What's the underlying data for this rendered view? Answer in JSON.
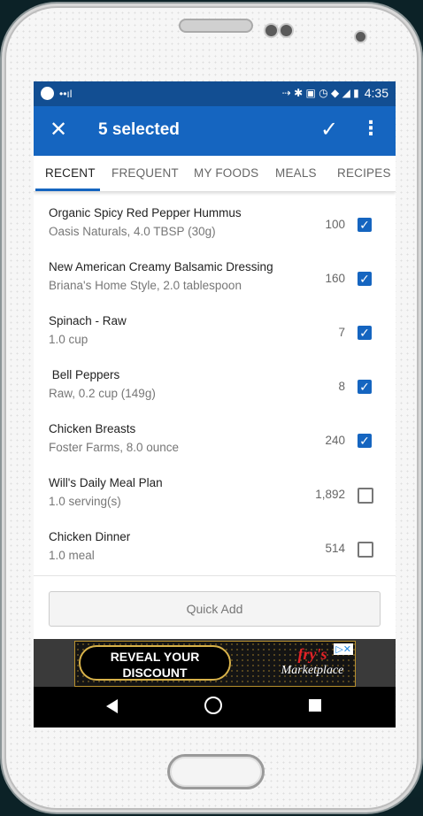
{
  "statusbar": {
    "time": "4:35",
    "signal": "••ıl",
    "icons_right": "⇢ ✱ ▣ ◷ ◆ ◢ ▮"
  },
  "appbar": {
    "close_icon": "✕",
    "title": "5 selected",
    "check_icon": "✓",
    "more_icon": "⋮"
  },
  "tabs": [
    {
      "label": "RECENT",
      "active": true
    },
    {
      "label": "FREQUENT",
      "active": false
    },
    {
      "label": "MY FOODS",
      "active": false
    },
    {
      "label": "MEALS",
      "active": false
    },
    {
      "label": "RECIPES",
      "active": false
    }
  ],
  "items": [
    {
      "name": "Organic Spicy Red Pepper Hummus",
      "detail": "Oasis Naturals, 4.0 TBSP (30g)",
      "calories": "100",
      "checked": true
    },
    {
      "name": "New American Creamy Balsamic Dressing",
      "detail": "Briana's Home Style, 2.0 tablespoon",
      "calories": "160",
      "checked": true
    },
    {
      "name": "Spinach - Raw",
      "detail": "1.0 cup",
      "calories": "7",
      "checked": true
    },
    {
      "name": " Bell Peppers",
      "detail": "Raw, 0.2 cup (149g)",
      "calories": "8",
      "checked": true
    },
    {
      "name": "Chicken Breasts",
      "detail": "Foster Farms, 8.0 ounce",
      "calories": "240",
      "checked": true
    },
    {
      "name": "Will's Daily Meal Plan",
      "detail": "1.0 serving(s)",
      "calories": "1,892",
      "checked": false
    },
    {
      "name": "Chicken Dinner",
      "detail": "1.0 meal",
      "calories": "514",
      "checked": false
    }
  ],
  "quick_add_label": "Quick Add",
  "ad": {
    "line1": "REVEAL YOUR",
    "line2": "DISCOUNT",
    "brand": "fry's",
    "brand_sub": "Marketplace",
    "close": "▷✕"
  },
  "colors": {
    "appbar": "#1565c0",
    "statusbar": "#124e92",
    "checkbox": "#1565c0"
  }
}
